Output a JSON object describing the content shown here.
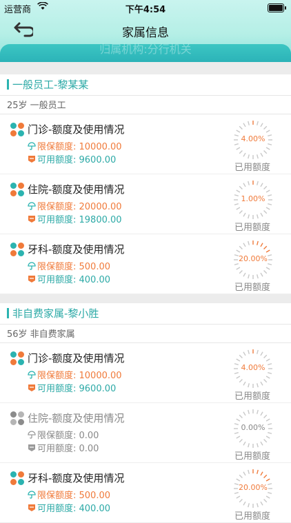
{
  "status_bar": {
    "carrier": "运营商",
    "time": "下午4:54"
  },
  "header": {
    "title": "家属信息",
    "banner_text": "归属机构:分行机关"
  },
  "sections": [
    {
      "title": "一般员工-黎某某",
      "subtitle": "25岁 一般员工",
      "items": [
        {
          "name": "门诊-额度及使用情况",
          "limit": "限保额度: 10000.00",
          "available": "可用额度: 9600.00",
          "percent": "4.00%",
          "used_label": "已用额度",
          "active": true
        },
        {
          "name": "住院-额度及使用情况",
          "limit": "限保额度: 20000.00",
          "available": "可用额度: 19800.00",
          "percent": "1.00%",
          "used_label": "已用额度",
          "active": true
        },
        {
          "name": "牙科-额度及使用情况",
          "limit": "限保额度: 500.00",
          "available": "可用额度: 400.00",
          "percent": "20.00%",
          "used_label": "已用额度",
          "active": true
        }
      ]
    },
    {
      "title": "非自费家属-黎小胜",
      "subtitle": "56岁 非自费家属",
      "items": [
        {
          "name": "门诊-额度及使用情况",
          "limit": "限保额度: 10000.00",
          "available": "可用额度: 9600.00",
          "percent": "4.00%",
          "used_label": "已用额度",
          "active": true
        },
        {
          "name": "住院-额度及使用情况",
          "limit": "限保额度: 0.00",
          "available": "可用额度: 0.00",
          "percent": "0.00%",
          "used_label": "已用额度",
          "active": false
        },
        {
          "name": "牙科-额度及使用情况",
          "limit": "限保额度: 500.00",
          "available": "可用额度: 400.00",
          "percent": "20.00%",
          "used_label": "已用额度",
          "active": true
        }
      ]
    }
  ],
  "colors": {
    "accent": "#2bb3b0",
    "orange": "#f07a3a",
    "gray": "#9a9a9a"
  },
  "icons": {
    "back": "back-arrow-icon",
    "logo": "four-petal-logo-icon",
    "limit": "umbrella-icon",
    "available": "wallet-icon",
    "wifi": "wifi-icon",
    "battery": "battery-icon"
  }
}
